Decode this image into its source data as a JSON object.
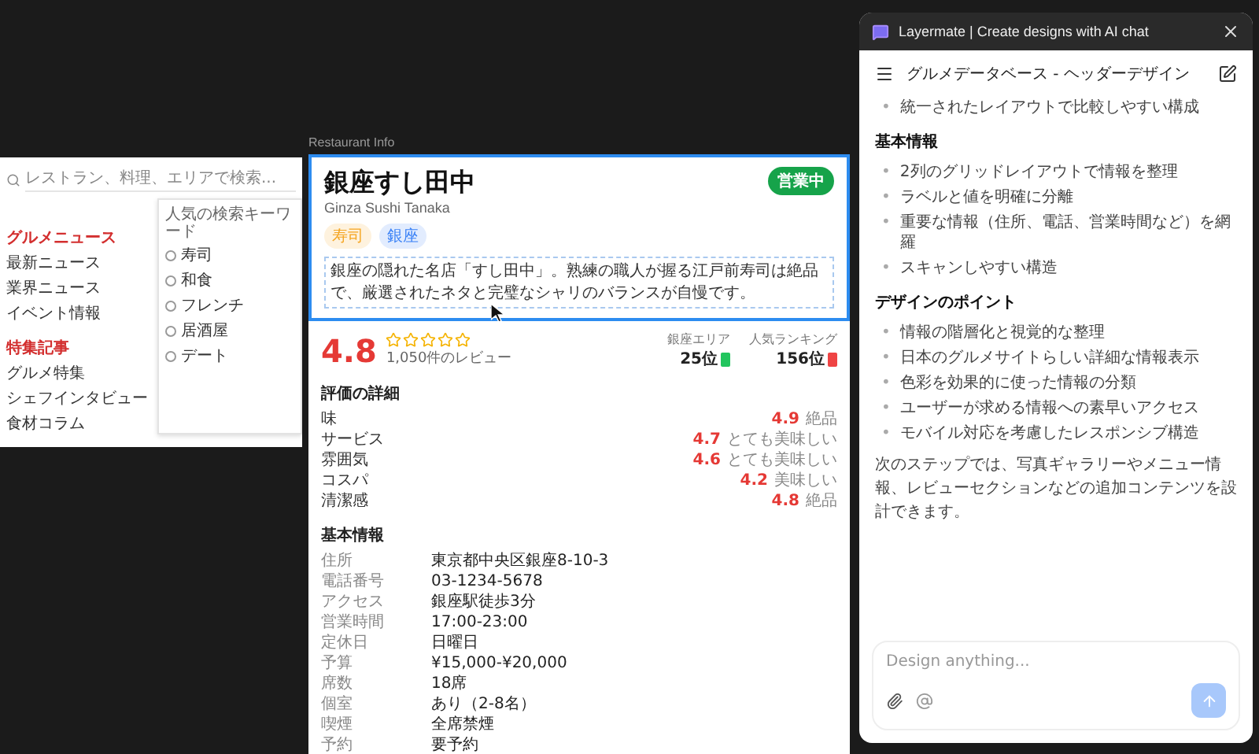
{
  "left_frame": {
    "search": {
      "placeholder": "レストラン、料理、エリアで検索..."
    },
    "nav_groups": [
      {
        "title": "グルメニュース",
        "items": [
          "最新ニュース",
          "業界ニュース",
          "イベント情報"
        ]
      },
      {
        "title": "特集記事",
        "items": [
          "グルメ特集",
          "シェフインタビュー",
          "食材コラム"
        ]
      }
    ],
    "dropdown": {
      "title": "人気の検索キーワード",
      "items": [
        "寿司",
        "和食",
        "フレンチ",
        "居酒屋",
        "デート"
      ]
    }
  },
  "restaurant_frame": {
    "label": "Restaurant Info",
    "header": {
      "name": "銀座すし田中",
      "romaji": "Ginza Sushi Tanaka",
      "status": "営業中",
      "tags": [
        {
          "label": "寿司",
          "color": "#f5a623"
        },
        {
          "label": "銀座",
          "color": "#3b82f6"
        }
      ],
      "description": "銀座の隠れた名店「すし田中」。熟練の職人が握る江戸前寿司は絶品で、厳選されたネタと完璧なシャリのバランスが自慢です。"
    },
    "summary": {
      "score": "4.8",
      "stars": 0,
      "reviews": "1,050件のレビュー",
      "rankings": [
        {
          "label": "銀座エリア",
          "value": "25位",
          "color": "#22c55e"
        },
        {
          "label": "人気ランキング",
          "value": "156位",
          "color": "#ef4444"
        }
      ]
    },
    "ratings": {
      "title": "評価の詳細",
      "rows": [
        {
          "label": "味",
          "score": "4.9",
          "comment": "絶品"
        },
        {
          "label": "サービス",
          "score": "4.7",
          "comment": "とても美味しい"
        },
        {
          "label": "雰囲気",
          "score": "4.6",
          "comment": "とても美味しい"
        },
        {
          "label": "コスパ",
          "score": "4.2",
          "comment": "美味しい"
        },
        {
          "label": "清潔感",
          "score": "4.8",
          "comment": "絶品"
        }
      ]
    },
    "basic_info": {
      "title": "基本情報",
      "rows": [
        {
          "label": "住所",
          "value": "東京都中央区銀座8-10-3"
        },
        {
          "label": "電話番号",
          "value": "03-1234-5678"
        },
        {
          "label": "アクセス",
          "value": "銀座駅徒歩3分"
        },
        {
          "label": "営業時間",
          "value": "17:00-23:00"
        },
        {
          "label": "定休日",
          "value": "日曜日"
        },
        {
          "label": "予算",
          "value": "¥15,000-¥20,000"
        },
        {
          "label": "席数",
          "value": "18席"
        },
        {
          "label": "個室",
          "value": "あり（2-8名）"
        },
        {
          "label": "喫煙",
          "value": "全席禁煙"
        },
        {
          "label": "予約",
          "value": "要予約"
        }
      ]
    }
  },
  "chat": {
    "title": "Layermate | Create designs with AI chat",
    "conversation": "グルメデータベース - ヘッダーデザイン",
    "blocks": [
      {
        "kind": "list",
        "marker": "•",
        "items": [
          "統一されたレイアウトで比較しやすい構成"
        ]
      },
      {
        "kind": "heading",
        "text": "基本情報"
      },
      {
        "kind": "list",
        "marker": "•",
        "items": [
          "2列のグリッドレイアウトで情報を整理",
          "ラベルと値を明確に分離",
          "重要な情報（住所、電話、営業時間など）を網羅",
          "スキャンしやすい構造"
        ]
      },
      {
        "kind": "heading",
        "text": "デザインのポイント"
      },
      {
        "kind": "list",
        "marker": "•",
        "items": [
          "情報の階層化と視覚的な整理",
          "日本のグルメサイトらしい詳細な情報表示",
          "色彩を効果的に使った情報の分類",
          "ユーザーが求める情報への素早いアクセス",
          "モバイル対応を考慮したレスポンシブ構造"
        ]
      },
      {
        "kind": "paragraph",
        "text": "次のステップでは、写真ギャラリーやメニュー情報、レビューセクションなどの追加コンテンツを設計できます。"
      }
    ],
    "input": {
      "placeholder": "Design anything..."
    }
  }
}
